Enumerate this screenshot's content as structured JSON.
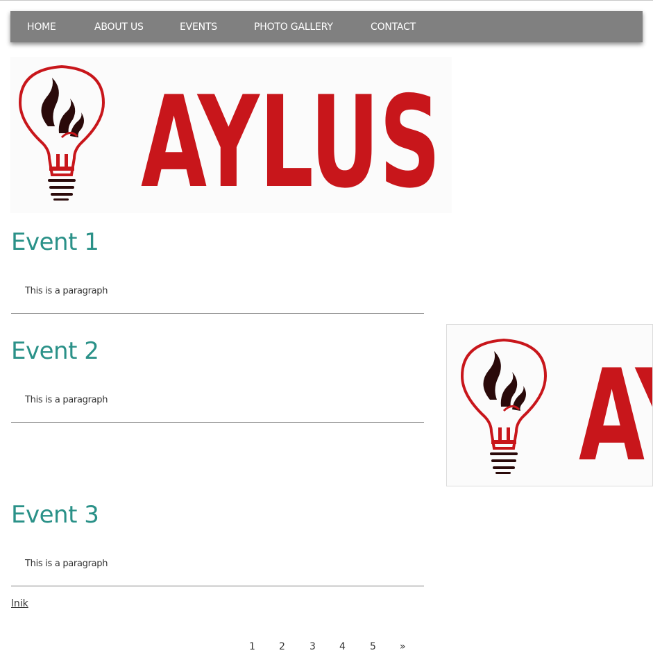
{
  "nav": {
    "items": [
      "HOME",
      "ABOUT US",
      "EVENTS",
      "PHOTO GALLERY",
      "CONTACT"
    ]
  },
  "logo": {
    "wordmark": "AYLUS",
    "icon": "lightbulb-flame-icon",
    "colors": {
      "red": "#c8161b",
      "dark": "#2a0a0a"
    }
  },
  "events": [
    {
      "title": "Event 1",
      "paragraph": "This is a paragraph"
    },
    {
      "title": "Event 2",
      "paragraph": "This is a paragraph"
    },
    {
      "title": "Event 3",
      "paragraph": "This is a paragraph"
    }
  ],
  "link": {
    "label": "lnik"
  },
  "pagination": {
    "pages": [
      "1",
      "2",
      "3",
      "4",
      "5"
    ],
    "next": "»"
  },
  "colors": {
    "nav_bg": "#808080",
    "heading": "#2a9188",
    "text": "#333333"
  }
}
